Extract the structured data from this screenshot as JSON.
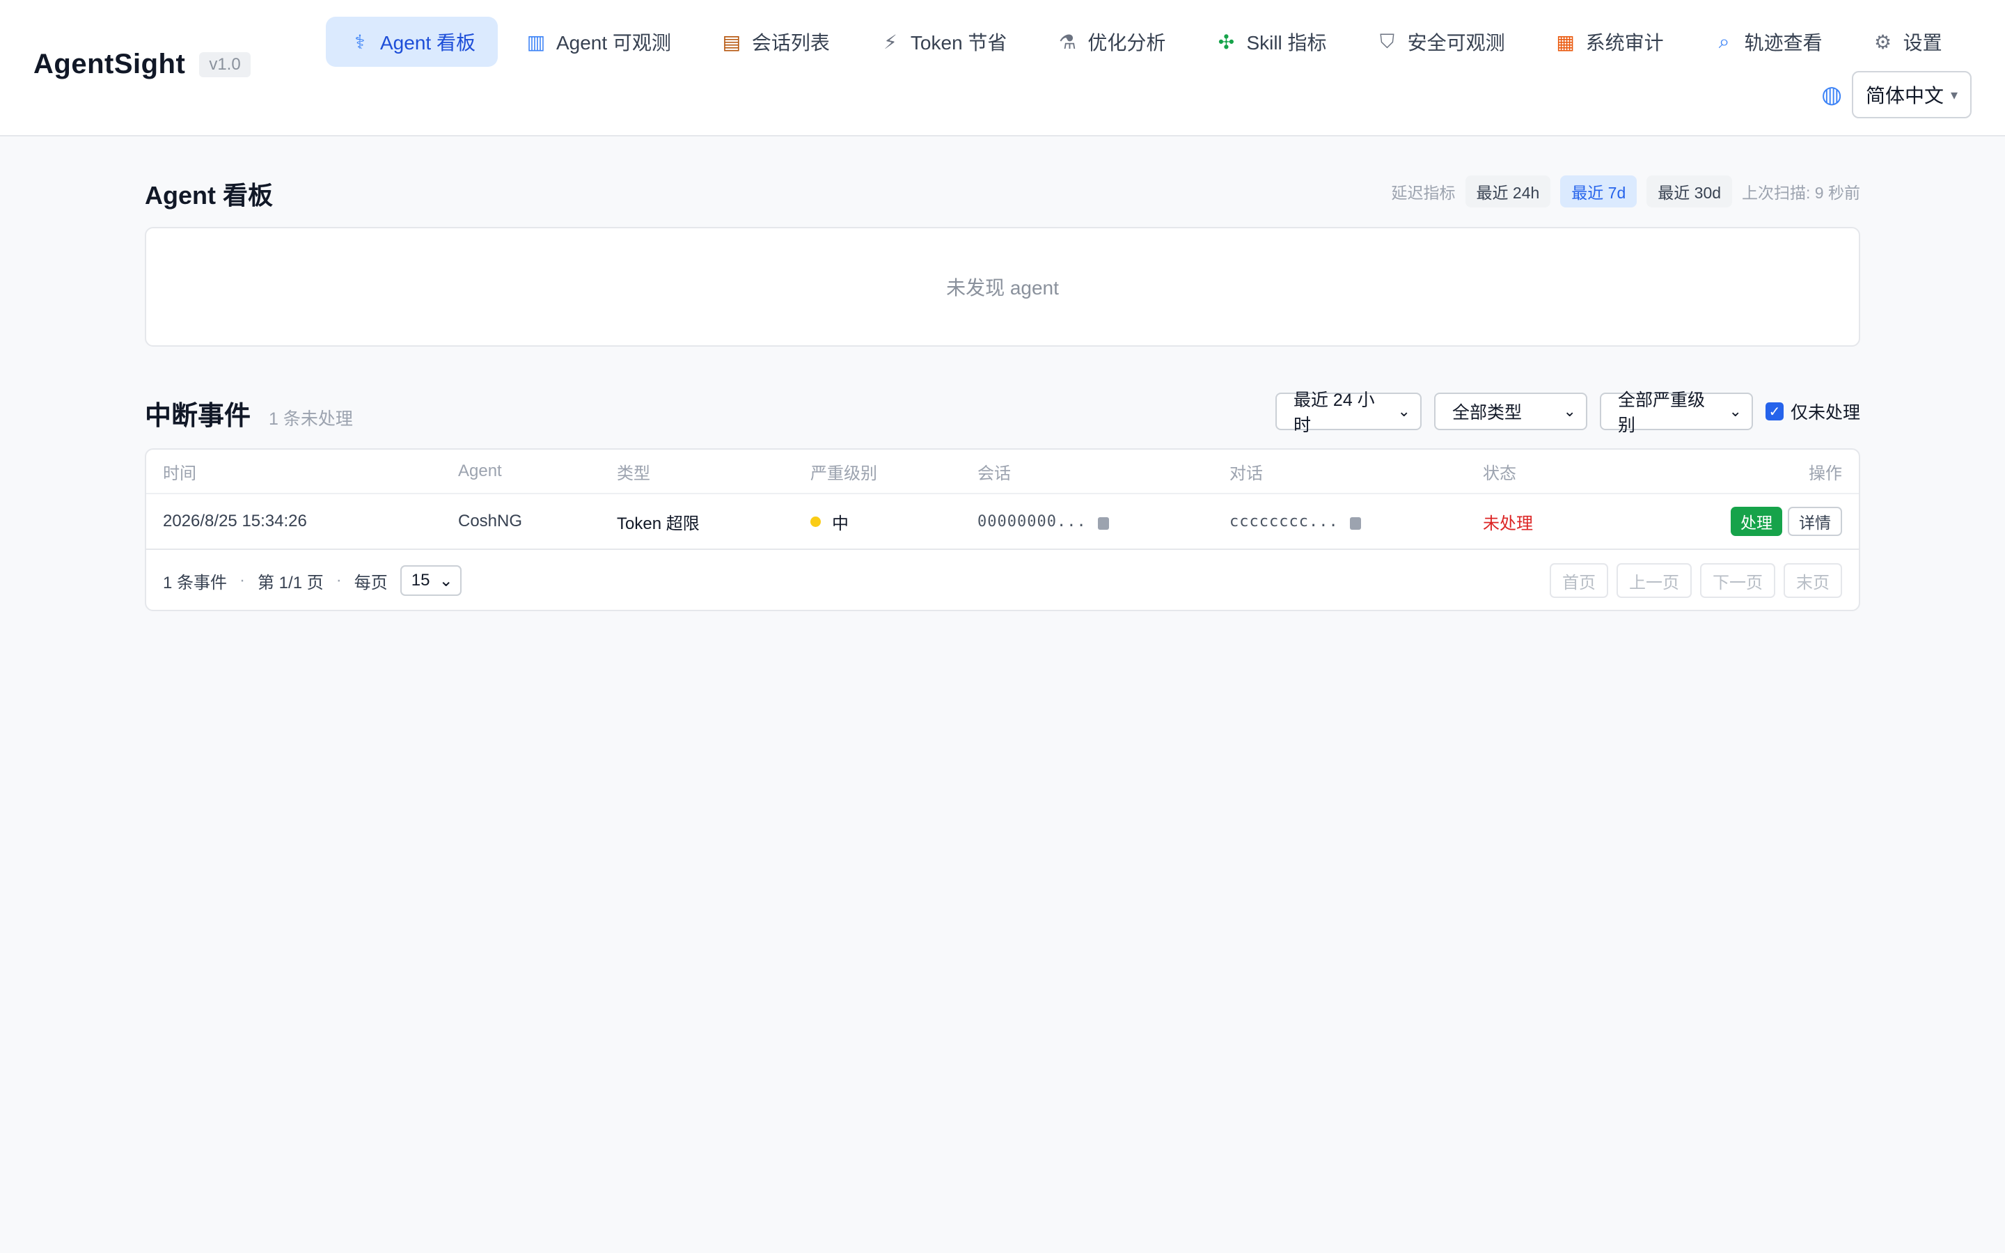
{
  "app": {
    "name": "AgentSight",
    "version": "v1.0"
  },
  "nav": [
    {
      "label": "Agent 看板",
      "icon": "stethoscope-icon",
      "glyph": "⚕",
      "active": true
    },
    {
      "label": "Agent 可观测",
      "icon": "bar-chart-icon",
      "glyph": "▥",
      "active": false
    },
    {
      "label": "会话列表",
      "icon": "card-index-icon",
      "glyph": "▤",
      "active": false
    },
    {
      "label": "Token 节省",
      "icon": "lightning-icon",
      "glyph": "⚡",
      "active": false
    },
    {
      "label": "优化分析",
      "icon": "microscope-icon",
      "glyph": "⚗",
      "active": false
    },
    {
      "label": "Skill 指标",
      "icon": "puzzle-icon",
      "glyph": "✣",
      "active": false
    },
    {
      "label": "安全可观测",
      "icon": "shield-icon",
      "glyph": "⛉",
      "active": false
    },
    {
      "label": "系统审计",
      "icon": "clipboard-icon",
      "glyph": "▦",
      "active": false
    },
    {
      "label": "轨迹查看",
      "icon": "magnifier-icon",
      "glyph": "⌕",
      "active": false
    },
    {
      "label": "设置",
      "icon": "gear-icon",
      "glyph": "⚙",
      "active": false
    }
  ],
  "language": {
    "icon": "globe-icon",
    "glyph": "◍",
    "value": "简体中文",
    "caret": "▾"
  },
  "dashboard": {
    "title": "Agent 看板",
    "latency_label": "延迟指标",
    "ranges": [
      {
        "label": "最近 24h",
        "active": false
      },
      {
        "label": "最近 7d",
        "active": true
      },
      {
        "label": "最近 30d",
        "active": false
      }
    ],
    "last_scan": "上次扫描: 9 秒前",
    "empty_text": "未发现 agent"
  },
  "events": {
    "title": "中断事件",
    "count_text": "1 条未处理",
    "filters": {
      "time": "最近 24 小时",
      "type": "全部类型",
      "severity": "全部严重级别",
      "unhandled_only": "仅未处理",
      "chevron": "⌄",
      "check": "✓"
    },
    "columns": {
      "time": "时间",
      "agent": "Agent",
      "type": "类型",
      "severity": "严重级别",
      "session": "会话",
      "conversation": "对话",
      "status": "状态",
      "actions": "操作"
    },
    "rows": [
      {
        "time": "2026/8/25 15:34:26",
        "agent": "CoshNG",
        "type": "Token 超限",
        "severity": "中",
        "severity_color": "#facc15",
        "session": "00000000...",
        "conversation": "cccccccc...",
        "status": "未处理",
        "status_color": "#dc2626",
        "handle_label": "处理",
        "detail_label": "详情"
      }
    ],
    "footer": {
      "total": "1 条事件",
      "sep": "·",
      "page": "第 1/1 页",
      "per_page_label": "每页",
      "per_page": "15",
      "first": "首页",
      "prev": "上一页",
      "next": "下一页",
      "last": "末页"
    }
  },
  "colors": {
    "accent": "#2563eb",
    "active_nav_bg": "#dbeafe",
    "success": "#16a34a",
    "danger": "#dc2626",
    "warning": "#facc15"
  }
}
